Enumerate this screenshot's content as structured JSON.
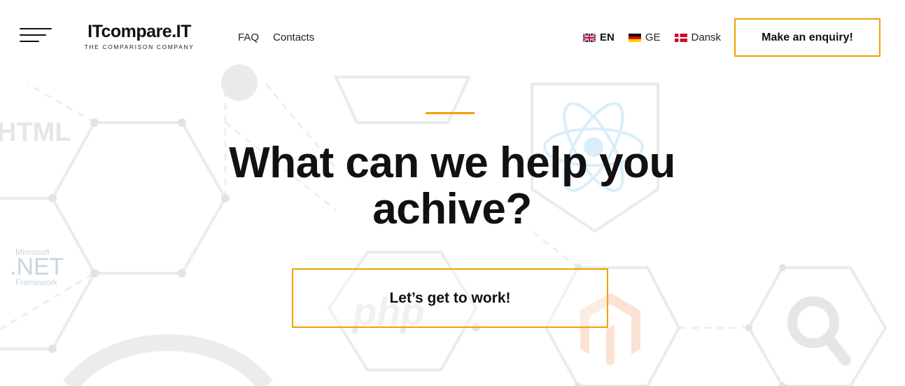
{
  "header": {
    "menu_icon": "hamburger-menu-icon",
    "logo": {
      "name": "ITcompare.IT",
      "tagline": "THE COMPARISON COMPANY"
    },
    "nav": [
      {
        "label": "FAQ"
      },
      {
        "label": "Contacts"
      }
    ],
    "languages": [
      {
        "code": "EN",
        "flag": "uk-flag-icon",
        "active": true
      },
      {
        "code": "GE",
        "flag": "germany-flag-icon",
        "active": false
      },
      {
        "code": "Dansk",
        "flag": "denmark-flag-icon",
        "active": false
      }
    ],
    "cta_label": "Make an enquiry!"
  },
  "hero": {
    "title": "What can we help you achive?",
    "button_label": "Let’s get to work!"
  },
  "background": {
    "tech_logos": [
      "HTML",
      "Microsoft",
      ".NET",
      "Framework",
      "php",
      "react-logo-icon",
      "magento-logo-icon",
      "search-icon"
    ]
  },
  "colors": {
    "accent": "#f2a000",
    "text": "#111111",
    "background": "#ffffff",
    "pattern": "#e6e6e6"
  }
}
